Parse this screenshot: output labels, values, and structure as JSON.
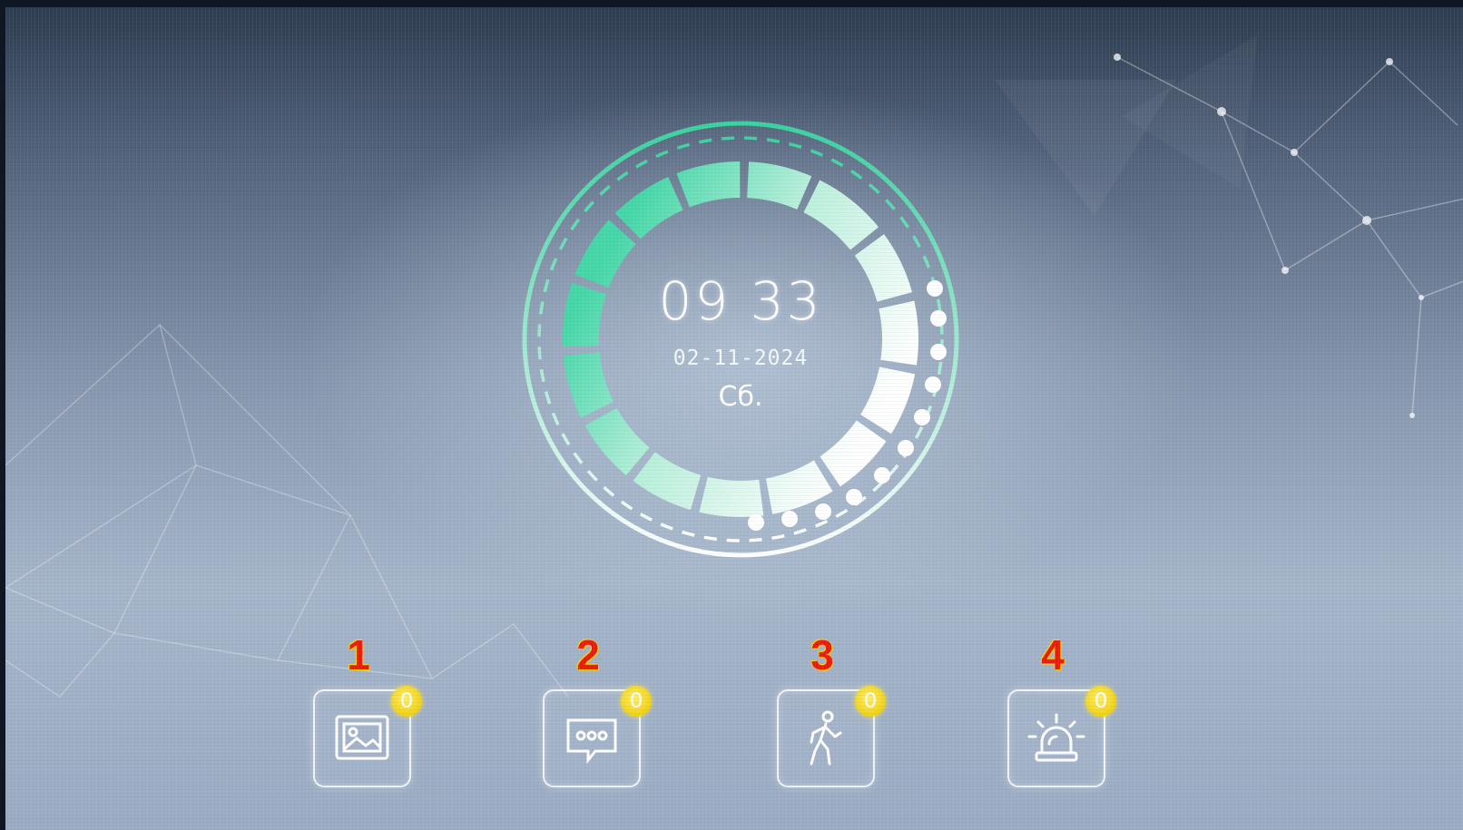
{
  "clock": {
    "time": "09 33",
    "date": "02-11-2024",
    "weekday": "Сб."
  },
  "dock": {
    "items": [
      {
        "step": "1",
        "icon": "gallery-icon",
        "badge": "0"
      },
      {
        "step": "2",
        "icon": "message-icon",
        "badge": "0"
      },
      {
        "step": "3",
        "icon": "motion-icon",
        "badge": "0"
      },
      {
        "step": "4",
        "icon": "alarm-icon",
        "badge": "0"
      }
    ]
  },
  "colors": {
    "accent": "#3fd0a0",
    "badge": "#f1d10e",
    "step_number": "#ee1a0e"
  }
}
